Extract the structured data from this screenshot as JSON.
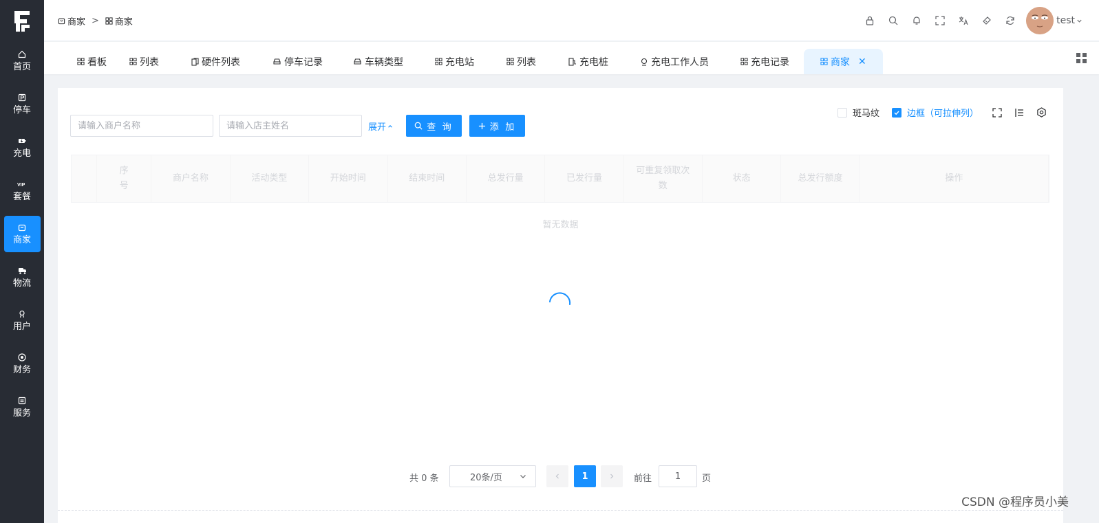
{
  "sidebar": {
    "items": [
      {
        "label": "首页",
        "icon": "home-icon"
      },
      {
        "label": "停车",
        "icon": "parking-icon"
      },
      {
        "label": "充电",
        "icon": "charge-icon"
      },
      {
        "label": "套餐",
        "icon": "vip-icon"
      },
      {
        "label": "商家",
        "icon": "shop-icon",
        "active": true
      },
      {
        "label": "物流",
        "icon": "truck-icon"
      },
      {
        "label": "用户",
        "icon": "user-icon"
      },
      {
        "label": "财务",
        "icon": "finance-icon"
      },
      {
        "label": "服务",
        "icon": "service-icon"
      }
    ]
  },
  "header": {
    "breadcrumb": [
      "商家",
      "商家"
    ],
    "breadcrumb_sep": ">",
    "username": "test"
  },
  "tabs": [
    {
      "label": "看板"
    },
    {
      "label": "列表"
    },
    {
      "label": "硬件列表"
    },
    {
      "label": "停车记录"
    },
    {
      "label": "车辆类型"
    },
    {
      "label": "充电站"
    },
    {
      "label": "列表"
    },
    {
      "label": "充电桩"
    },
    {
      "label": "充电工作人员"
    },
    {
      "label": "充电记录"
    },
    {
      "label": "商家",
      "active": true
    }
  ],
  "search": {
    "merchant_placeholder": "请输入商户名称",
    "owner_placeholder": "请输入店主姓名",
    "expand_label": "展开",
    "query_label": "查 询",
    "add_label": "添 加"
  },
  "options": {
    "stripe_label": "斑马纹",
    "stripe_checked": false,
    "border_label": "边框（可拉伸列）",
    "border_checked": true
  },
  "table": {
    "columns": [
      "序号",
      "商户名称",
      "活动类型",
      "开始时间",
      "结束时间",
      "总发行量",
      "已发行量",
      "可重复领取次数",
      "状态",
      "总发行额度",
      "操作"
    ],
    "empty_text": "暂无数据"
  },
  "pagination": {
    "total_text": "共 0 条",
    "page_size": "20条/页",
    "current_page": "1",
    "goto_label": "前往",
    "goto_value": "1",
    "page_suffix": "页"
  },
  "watermark": "CSDN @程序员小美",
  "colors": {
    "accent": "#1890ff",
    "sidebar": "#282c34"
  }
}
